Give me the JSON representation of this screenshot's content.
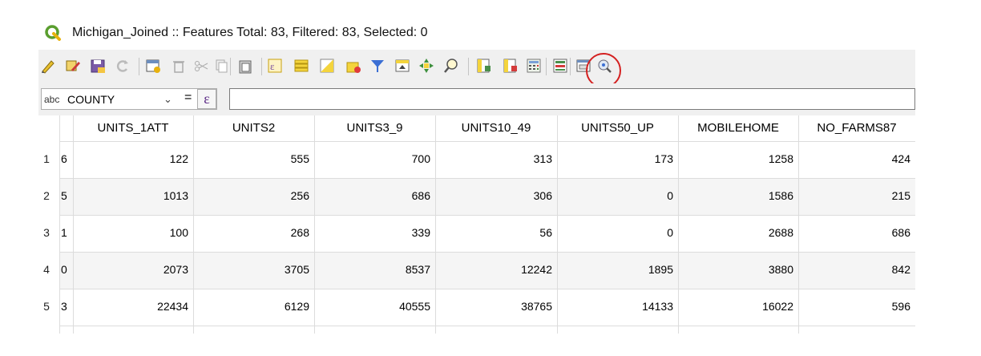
{
  "window": {
    "title": "Michigan_Joined :: Features Total: 83, Filtered: 83, Selected: 0"
  },
  "toolbar": {
    "icons": [
      "toggle-editing-icon",
      "multi-edit-icon",
      "save-edits-icon",
      "reload-icon",
      "add-feature-icon",
      "delete-feature-icon",
      "cut-icon",
      "copy-icon",
      "paste-icon",
      "select-by-expression-icon",
      "select-all-icon",
      "invert-selection-icon",
      "deselect-all-icon",
      "filter-icon",
      "move-selection-top-icon",
      "pan-to-selection-icon",
      "zoom-to-selection-icon",
      "new-field-icon",
      "delete-field-icon",
      "field-calculator-icon",
      "conditional-formatting-icon",
      "dock-table-icon",
      "actions-icon"
    ],
    "highlighted": "field-calculator-icon",
    "highlight_color": "#d42020"
  },
  "expression_bar": {
    "field_type": "abc",
    "field": "COUNTY",
    "equals": "=",
    "expr_symbol": "ε",
    "value": ""
  },
  "table": {
    "columns": [
      "UNITS_1ATT",
      "UNITS2",
      "UNITS3_9",
      "UNITS10_49",
      "UNITS50_UP",
      "MOBILEHOME",
      "NO_FARMS87"
    ],
    "rows": [
      {
        "num": "1",
        "prev": "6",
        "cells": [
          "122",
          "555",
          "700",
          "313",
          "173",
          "1258",
          "424"
        ]
      },
      {
        "num": "2",
        "prev": "5",
        "cells": [
          "1013",
          "256",
          "686",
          "306",
          "0",
          "1586",
          "215"
        ]
      },
      {
        "num": "3",
        "prev": "1",
        "cells": [
          "100",
          "268",
          "339",
          "56",
          "0",
          "2688",
          "686"
        ]
      },
      {
        "num": "4",
        "prev": "0",
        "cells": [
          "2073",
          "3705",
          "8537",
          "12242",
          "1895",
          "3880",
          "842"
        ]
      },
      {
        "num": "5",
        "prev": "3",
        "cells": [
          "22434",
          "6129",
          "40555",
          "38765",
          "14133",
          "16022",
          "596"
        ]
      }
    ]
  }
}
